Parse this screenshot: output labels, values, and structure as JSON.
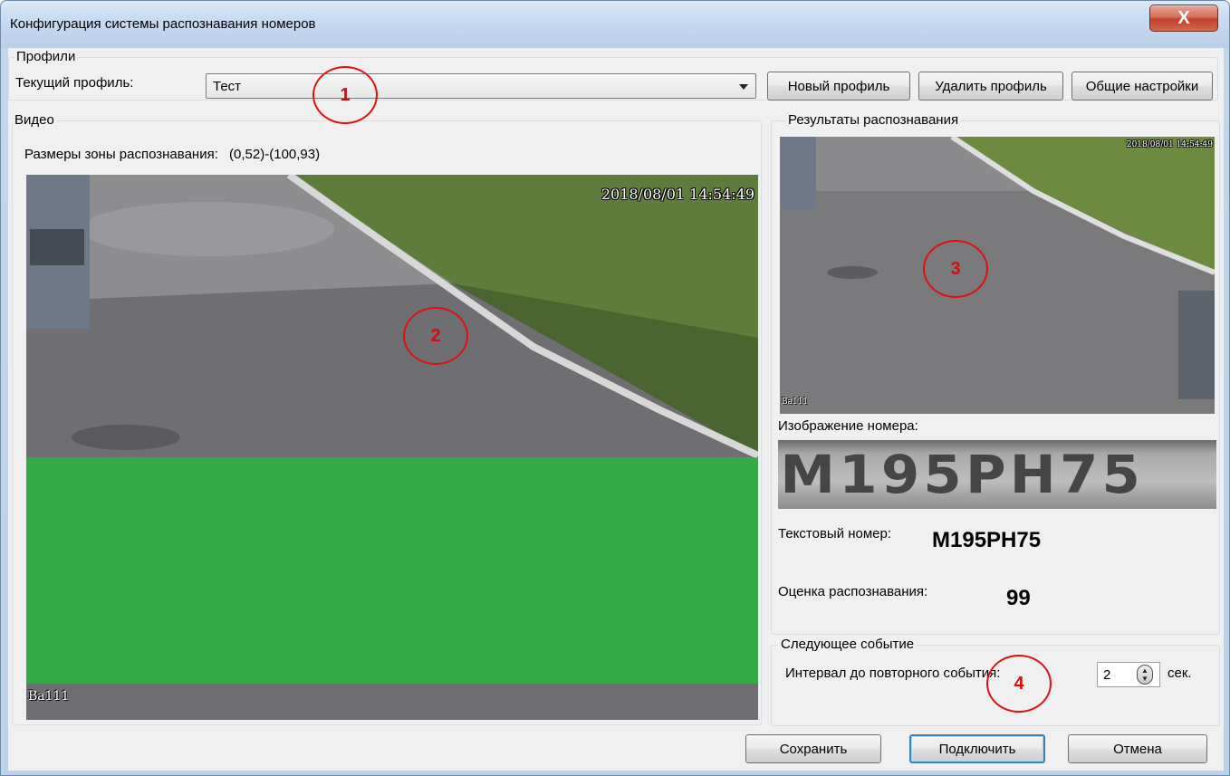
{
  "window": {
    "title": "Конфигурация системы распознавания номеров",
    "close_label": "X"
  },
  "profiles": {
    "group_label": "Профили",
    "current_label": "Текущий профиль:",
    "current_value": "Тест",
    "new_button": "Новый профиль",
    "delete_button": "Удалить профиль",
    "settings_button": "Общие настройки"
  },
  "video": {
    "group_label": "Видео",
    "zone_label": "Размеры зоны распознавания:",
    "zone_value": "(0,52)-(100,93)",
    "timestamp": "2018/08/01 14:54:49",
    "camera_label": "Ba111"
  },
  "results": {
    "group_label": "Результаты распознавания",
    "timestamp": "2018/08/01 14:54:49",
    "camera_label": "Ba111",
    "plate_image_label": "Изображение номера:",
    "plate_image_text": "M195PH75",
    "text_number_label": "Текстовый номер:",
    "text_number_value": "M195PH75",
    "score_label": "Оценка распознавания:",
    "score_value": "99"
  },
  "next_event": {
    "group_label": "Следующее событие",
    "interval_label": "Интервал до повторного события:",
    "interval_value": "2",
    "unit": "сек."
  },
  "footer": {
    "save_button": "Сохранить",
    "connect_button": "Подключить",
    "cancel_button": "Отмена"
  },
  "annotations": [
    "1",
    "2",
    "3",
    "4"
  ],
  "colors": {
    "annotation": "#e01010",
    "zone_overlay": "#28b93c",
    "default_button_border": "#3c7fb1"
  }
}
